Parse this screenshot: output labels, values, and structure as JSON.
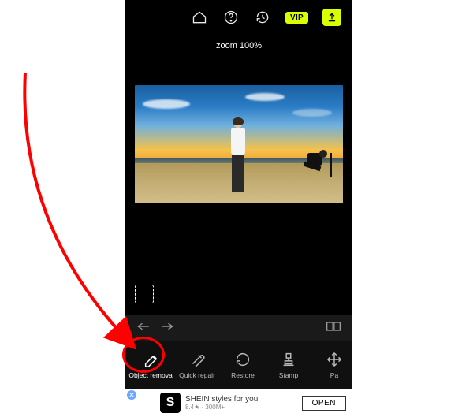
{
  "topbar": {
    "vip_label": "VIP"
  },
  "status": {
    "zoom_text": "zoom 100%"
  },
  "tools": [
    {
      "id": "object-removal",
      "label": "Object removal",
      "selected": true
    },
    {
      "id": "quick-repair",
      "label": "Quick repair",
      "selected": false
    },
    {
      "id": "restore",
      "label": "Restore",
      "selected": false
    },
    {
      "id": "stamp",
      "label": "Stamp",
      "selected": false
    },
    {
      "id": "pan",
      "label": "Pa",
      "selected": false
    }
  ],
  "ad": {
    "logo_letter": "S",
    "title": "SHEIN styles for you",
    "subtitle": "8.4★ · 300M+",
    "cta": "OPEN"
  },
  "colors": {
    "accent": "#d9ff00",
    "annotation": "#ff0000"
  }
}
